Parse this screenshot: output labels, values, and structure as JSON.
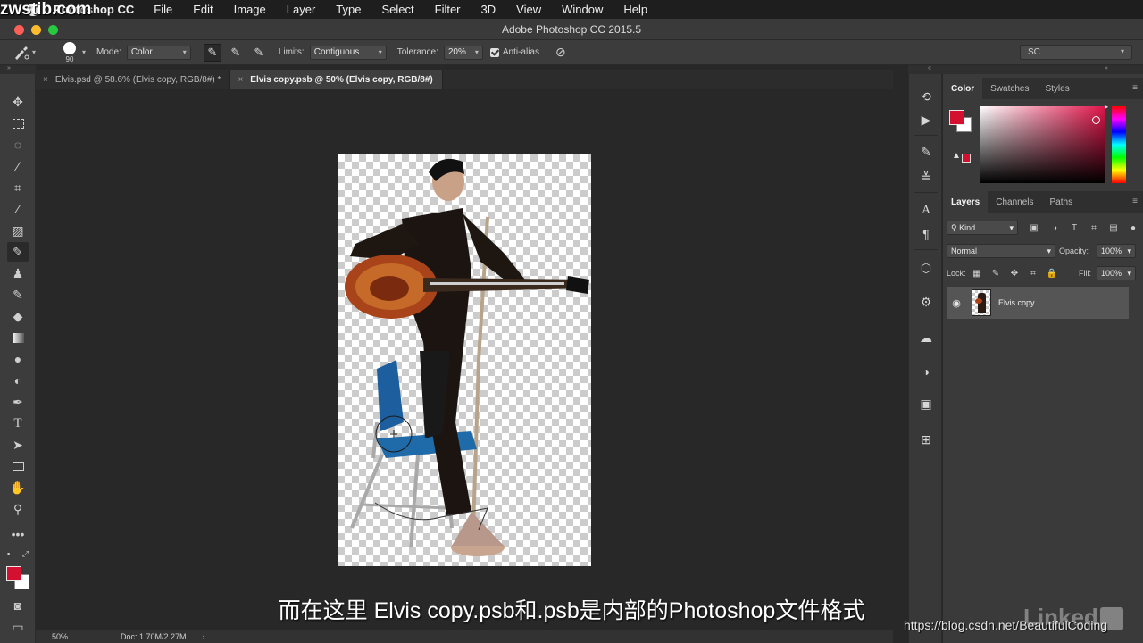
{
  "watermark_top": "zwstib.com",
  "menubar": {
    "app_name": "Photoshop CC",
    "items": [
      "File",
      "Edit",
      "Image",
      "Layer",
      "Type",
      "Select",
      "Filter",
      "3D",
      "View",
      "Window",
      "Help"
    ]
  },
  "window": {
    "title": "Adobe Photoshop CC 2015.5"
  },
  "options": {
    "brush_size": "90",
    "mode_label": "Mode:",
    "mode_value": "Color",
    "limits_label": "Limits:",
    "limits_value": "Contiguous",
    "tolerance_label": "Tolerance:",
    "tolerance_value": "20%",
    "antialias_label": "Anti-alias",
    "antialias_checked": true,
    "workspace": "SC"
  },
  "tabs": [
    {
      "label": "Elvis.psd @ 58.6% (Elvis copy, RGB/8#) *",
      "active": false
    },
    {
      "label": "Elvis copy.psb @ 50% (Elvis copy, RGB/8#)",
      "active": true
    }
  ],
  "colors": {
    "foreground": "#d3102f",
    "background": "#ffffff"
  },
  "status": {
    "zoom": "50%",
    "doc": "Doc: 1.70M/2.27M"
  },
  "color_panel": {
    "tabs": [
      "Color",
      "Swatches",
      "Styles"
    ],
    "active": "Color"
  },
  "layers_panel": {
    "tabs": [
      "Layers",
      "Channels",
      "Paths"
    ],
    "active": "Layers",
    "kind_filter": "Kind",
    "blend_mode": "Normal",
    "opacity_label": "Opacity:",
    "opacity_value": "100%",
    "lock_label": "Lock:",
    "fill_label": "Fill:",
    "fill_value": "100%",
    "layers": [
      {
        "name": "Elvis copy",
        "visible": true
      }
    ]
  },
  "subtitle": "而在这里  Elvis copy.psb和.psb是内部的Photoshop文件格式",
  "watermark_bottom": "https://blog.csdn.net/BeautifulCoding",
  "brand_watermark": "Linked"
}
